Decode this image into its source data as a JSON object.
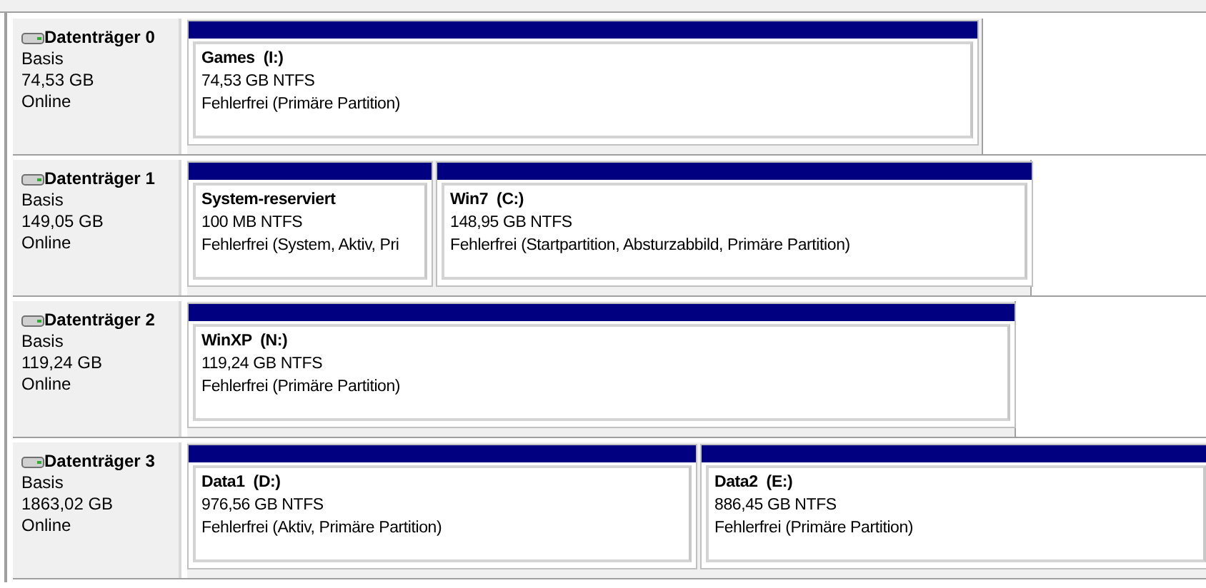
{
  "disks": [
    {
      "name": "Datenträger 0",
      "type": "Basis",
      "size": "74,53 GB",
      "status": "Online",
      "partitions": [
        {
          "label": "Games  (I:)",
          "size": "74,53 GB NTFS",
          "status": "Fehlerfrei (Primäre Partition)"
        }
      ]
    },
    {
      "name": "Datenträger 1",
      "type": "Basis",
      "size": "149,05 GB",
      "status": "Online",
      "partitions": [
        {
          "label": "System-reserviert",
          "size": "100 MB NTFS",
          "status": "Fehlerfrei (System, Aktiv, Pri"
        },
        {
          "label": "Win7  (C:)",
          "size": "148,95 GB NTFS",
          "status": "Fehlerfrei (Startpartition, Absturzabbild, Primäre Partition)"
        }
      ]
    },
    {
      "name": "Datenträger 2",
      "type": "Basis",
      "size": "119,24 GB",
      "status": "Online",
      "partitions": [
        {
          "label": "WinXP  (N:)",
          "size": "119,24 GB NTFS",
          "status": "Fehlerfrei (Primäre Partition)"
        }
      ]
    },
    {
      "name": "Datenträger 3",
      "type": "Basis",
      "size": "1863,02 GB",
      "status": "Online",
      "partitions": [
        {
          "label": "Data1  (D:)",
          "size": "976,56 GB NTFS",
          "status": "Fehlerfrei (Aktiv, Primäre Partition)"
        },
        {
          "label": "Data2  (E:)",
          "size": "886,45 GB NTFS",
          "status": "Fehlerfrei (Primäre Partition)"
        }
      ]
    }
  ]
}
